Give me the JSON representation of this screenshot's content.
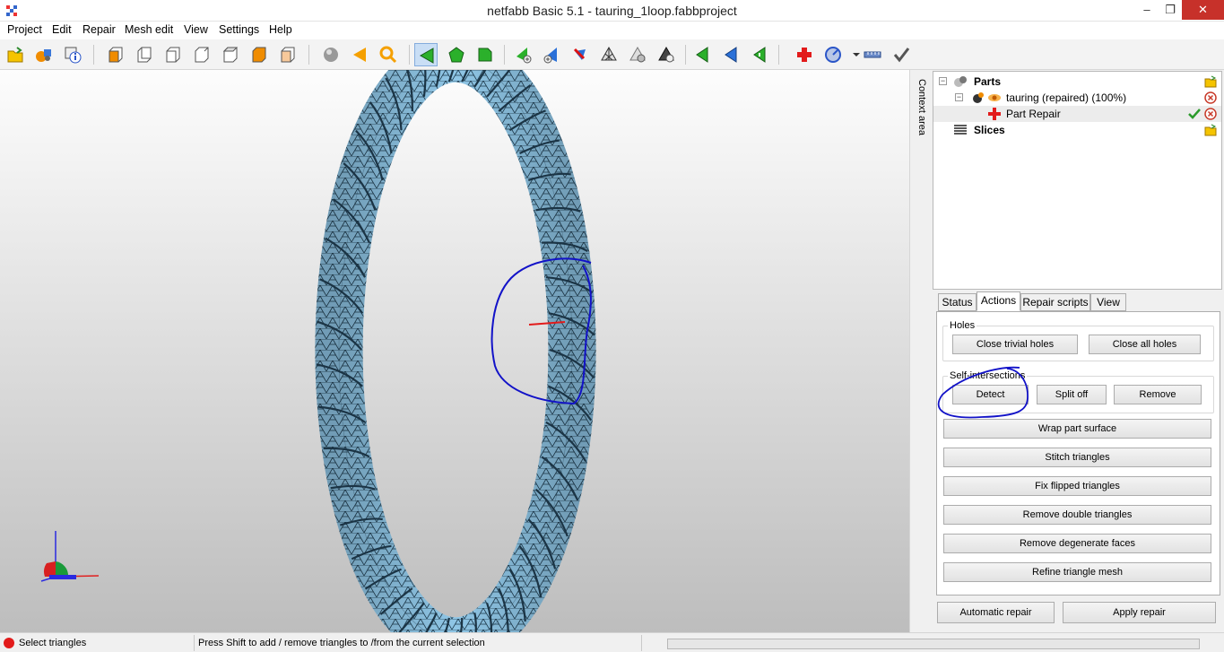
{
  "window": {
    "title": "netfabb Basic 5.1 - tauring_1loop.fabbproject",
    "minimize": "–",
    "maximize": "❐",
    "close": "✕"
  },
  "menu": [
    "Project",
    "Edit",
    "Repair",
    "Mesh edit",
    "View",
    "Settings",
    "Help"
  ],
  "toolbar_icons": [
    "open-project-icon",
    "add-part-icon",
    "part-info-icon",
    "view-front-icon",
    "view-back-icon",
    "view-left-icon",
    "view-right-icon",
    "view-top-icon",
    "view-bottom-icon",
    "view-iso-icon",
    "sphere-icon",
    "triangle-shade-icon",
    "zoom-icon",
    "select-triangles-icon",
    "select-surfaces-icon",
    "select-shells-icon",
    "add-triangle-icon",
    "add-point-icon",
    "remove-triangle-icon",
    "mesh-icon",
    "delete-point-icon",
    "delete-shell-icon",
    "green-arrow-icon",
    "blue-arrow-icon",
    "green-arrow-select-icon",
    "repair-cross-icon",
    "settings-gauge-icon",
    "ruler-icon",
    "checkmark-icon"
  ],
  "context": {
    "label": "Context area"
  },
  "tree": {
    "parts": "Parts",
    "part_name": "tauring (repaired) (100%)",
    "repair": "Part Repair",
    "slices": "Slices"
  },
  "tabs": [
    "Status",
    "Actions",
    "Repair scripts",
    "View"
  ],
  "actions": {
    "holes_label": "Holes",
    "close_trivial": "Close trivial holes",
    "close_all": "Close all holes",
    "self_label": "Self-intersections",
    "detect": "Detect",
    "split_off": "Split off",
    "remove": "Remove",
    "wrap": "Wrap part surface",
    "stitch": "Stitch triangles",
    "fix_flipped": "Fix flipped triangles",
    "remove_double": "Remove double triangles",
    "remove_degenerate": "Remove degenerate faces",
    "refine": "Refine triangle mesh"
  },
  "bottom": {
    "auto_repair": "Automatic repair",
    "apply_repair": "Apply repair"
  },
  "status": {
    "mode": "Select triangles",
    "hint": "Press Shift to add / remove triangles to /from the current selection"
  },
  "colors": {
    "mesh": "#8fc6e6",
    "annotation": "#1212c8",
    "error_edge": "#e21b1b",
    "close_button": "#c7312a"
  }
}
